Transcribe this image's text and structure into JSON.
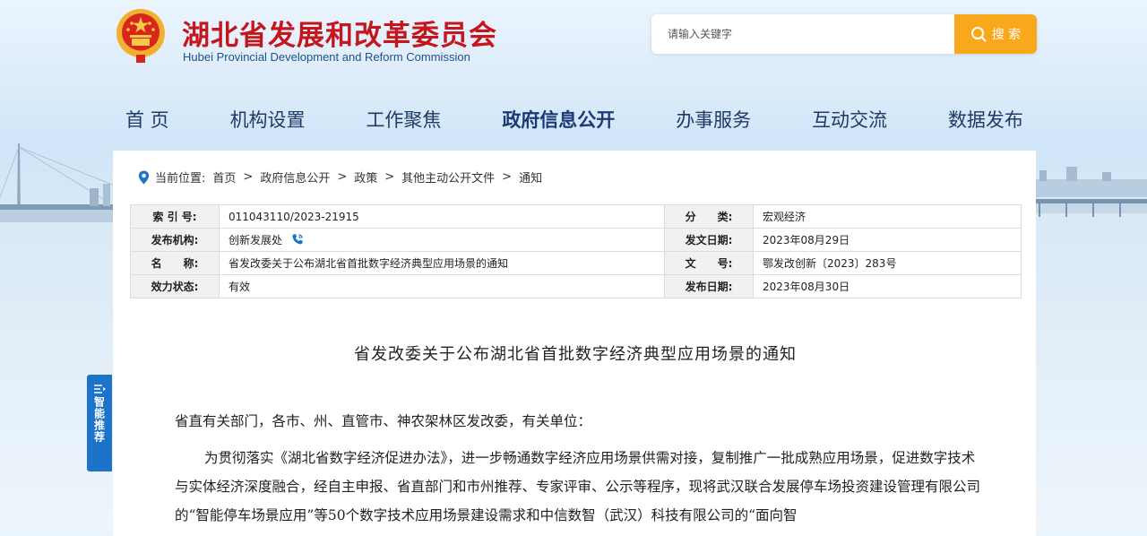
{
  "header": {
    "title_cn": "湖北省发展和改革委员会",
    "title_en": "Hubei Provincial Development and Reform Commission"
  },
  "search": {
    "placeholder": "请输入关键字",
    "button_label": "搜 索"
  },
  "nav": {
    "items": [
      "首 页",
      "机构设置",
      "工作聚焦",
      "政府信息公开",
      "办事服务",
      "互动交流",
      "数据发布"
    ],
    "active_index": 3
  },
  "breadcrumb": {
    "prefix": "当前位置:",
    "items": [
      "首页",
      "政府信息公开",
      "政策",
      "其他主动公开文件",
      "通知"
    ],
    "separator": ">"
  },
  "meta": {
    "index_no_label": "索 引 号:",
    "index_no": "011043110/2023-21915",
    "category_label": "分　　类:",
    "category": "宏观经济",
    "issuer_label": "发布机构:",
    "issuer": "创新发展处",
    "doc_date_label": "发文日期:",
    "doc_date": "2023年08月29日",
    "name_label": "名　　称:",
    "name": "省发改委关于公布湖北省首批数字经济典型应用场景的通知",
    "doc_no_label": "文　　号:",
    "doc_no": "鄂发改创新〔2023〕283号",
    "status_label": "效力状态:",
    "status": "有效",
    "publish_date_label": "发布日期:",
    "publish_date": "2023年08月30日"
  },
  "article": {
    "title": "省发改委关于公布湖北省首批数字经济典型应用场景的通知",
    "para1": "省直有关部门，各市、州、直管市、神农架林区发改委，有关单位：",
    "para2": "为贯彻落实《湖北省数字经济促进办法》，进一步畅通数字经济应用场景供需对接，复制推广一批成熟应用场景，促进数字技术与实体经济深度融合，经自主申报、省直部门和市州推荐、专家评审、公示等程序，现将武汉联合发展停车场投资建设管理有限公司的“智能停车场景应用”等50个数字技术应用场景建设需求和中信数智（武汉）科技有限公司的“面向智"
  },
  "side_tab": {
    "label": "智能推荐"
  },
  "colors": {
    "brand_red": "#c4161c",
    "accent_orange": "#f7a81b",
    "nav_blue": "#1f3b66",
    "side_tab_blue": "#1d73c9"
  }
}
